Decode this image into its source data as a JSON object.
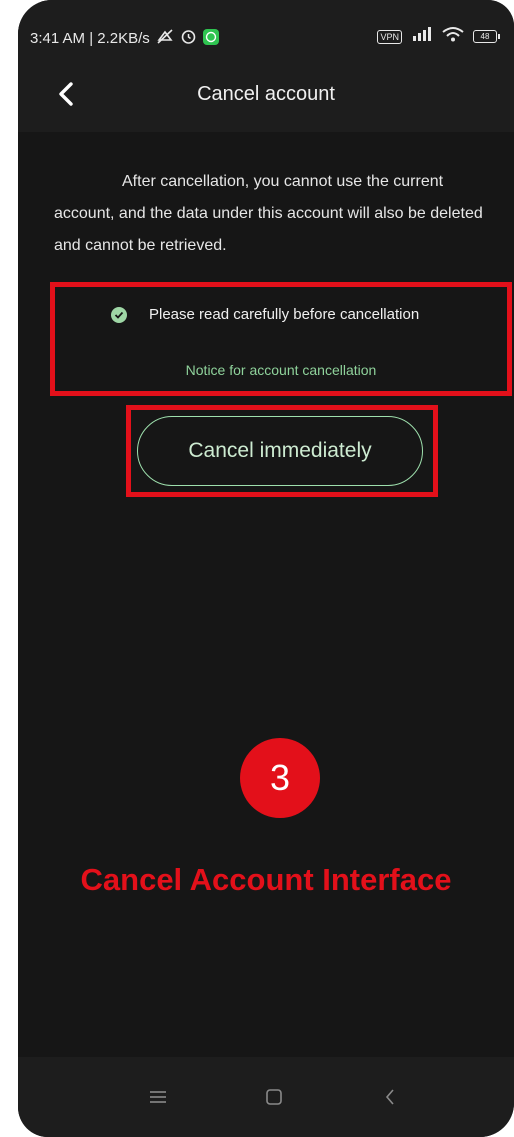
{
  "status_bar": {
    "time_speed": "3:41 AM | 2.2KB/s",
    "vpn_label": "VPN",
    "battery": "48"
  },
  "app_bar": {
    "title": "Cancel account"
  },
  "warning_text": "After cancellation, you cannot use the current account, and the data under this account will also be deleted and cannot be retrieved.",
  "notice": {
    "checkbox_label": "Please read carefully before cancellation",
    "checked": true,
    "link_text": "Notice for account cancellation"
  },
  "cancel_button_label": "Cancel immediately",
  "annotation": {
    "step_number": "3",
    "caption": "Cancel Account Interface"
  },
  "colors": {
    "background": "#161616",
    "bar": "#1d1d1d",
    "accent_green": "#8fd29b",
    "annotation_red": "#e3101a"
  }
}
